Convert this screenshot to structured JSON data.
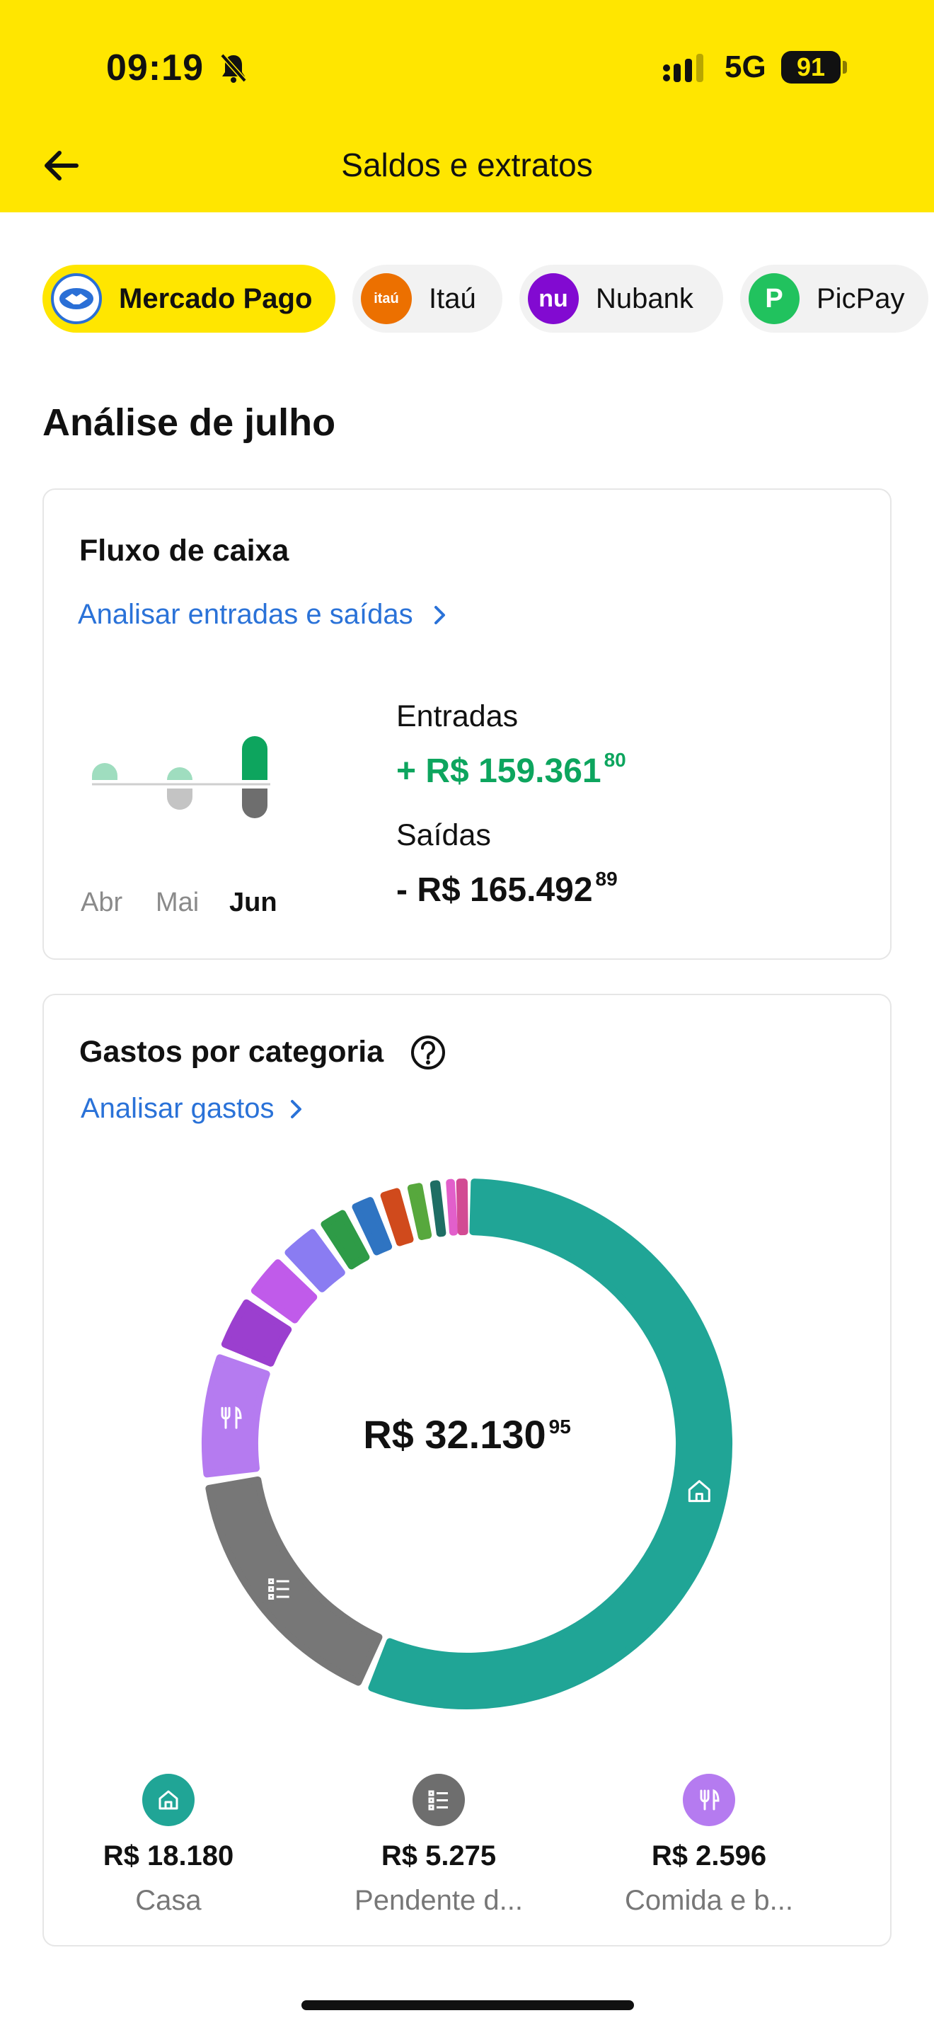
{
  "status_bar": {
    "time": "09:19",
    "network": "5G",
    "battery": "91"
  },
  "header": {
    "title": "Saldos e extratos"
  },
  "banks": [
    {
      "label": "Mercado Pago",
      "color": "#009EE3",
      "active": true
    },
    {
      "label": "Itaú",
      "logo_text": "itaú",
      "color": "#EC7000",
      "active": false
    },
    {
      "label": "Nubank",
      "logo_text": "nu",
      "color": "#820AD1",
      "active": false
    },
    {
      "label": "PicPay",
      "logo_text": "P",
      "color": "#21C25E",
      "active": false
    }
  ],
  "section_title": "Análise de julho",
  "cash_flow": {
    "title": "Fluxo de caixa",
    "link": "Analisar entradas e saídas",
    "months": [
      "Abr",
      "Mai",
      "Jun"
    ],
    "income_label": "Entradas",
    "income_prefix": "+",
    "income_value": "R$ 159.361",
    "income_cents": "80",
    "expense_label": "Saídas",
    "expense_prefix": "-",
    "expense_value": "R$ 165.492",
    "expense_cents": "89",
    "colors": {
      "income": "#0DA55E",
      "income_light": "#9FDDBF",
      "expense": "#6e6e6e",
      "expense_light": "#c4c4c4"
    }
  },
  "categories": {
    "title": "Gastos por categoria",
    "link": "Analisar gastos",
    "total_value": "R$ 32.130",
    "total_cents": "95",
    "legend": [
      {
        "value": "R$ 18.180",
        "name": "Casa",
        "icon": "home-icon",
        "color": "#20A596"
      },
      {
        "value": "R$ 5.275",
        "name": "Pendente d...",
        "icon": "list-icon",
        "color": "#6e6e6e"
      },
      {
        "value": "R$ 2.596",
        "name": "Comida e b...",
        "icon": "fork-knife-icon",
        "color": "#B57BF0"
      }
    ],
    "chart_data": {
      "type": "pie",
      "total": 32130.95,
      "slices": [
        {
          "name": "Casa",
          "value": 18180,
          "color": "#20A596"
        },
        {
          "name": "Pendente d...",
          "value": 5275,
          "color": "#777777"
        },
        {
          "name": "Comida e b...",
          "value": 2596,
          "color": "#B57BF0"
        },
        {
          "value": 1200,
          "color": "#9B3FCF"
        },
        {
          "value": 1000,
          "color": "#C05BEA"
        },
        {
          "value": 900,
          "color": "#8A7CF2"
        },
        {
          "value": 700,
          "color": "#2E9B47"
        },
        {
          "value": 600,
          "color": "#2F74C2"
        },
        {
          "value": 550,
          "color": "#D04A1C"
        },
        {
          "value": 450,
          "color": "#57A83D"
        },
        {
          "value": 350,
          "color": "#1E6E64"
        },
        {
          "value": 250,
          "color": "#E25FCB"
        },
        {
          "value": 200,
          "color": "#D24B93"
        }
      ]
    }
  }
}
